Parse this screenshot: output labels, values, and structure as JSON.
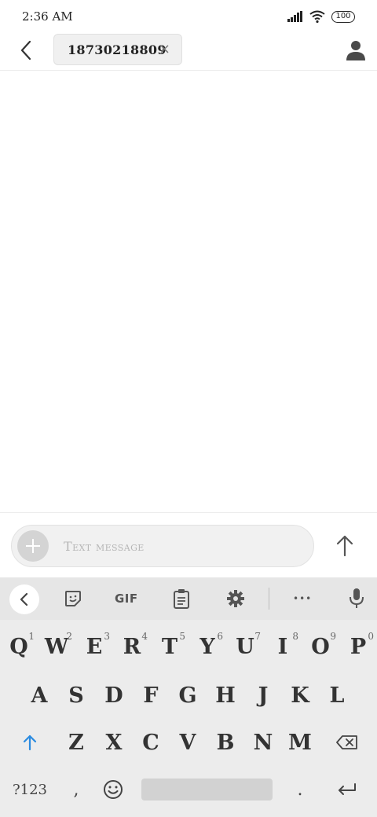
{
  "status_bar": {
    "time": "2:36 AM",
    "battery_level": "100",
    "icons": [
      "signal-icon",
      "wifi-icon",
      "battery-icon"
    ]
  },
  "header": {
    "recipient_chip": "18730218809",
    "chip_remove_symbol": "×"
  },
  "composer": {
    "placeholder": "Text message"
  },
  "keyboard": {
    "toolbar": {
      "gif_label": "GIF",
      "more_symbol": "•••"
    },
    "row1": [
      {
        "key": "Q",
        "hint": "1"
      },
      {
        "key": "W",
        "hint": "2"
      },
      {
        "key": "E",
        "hint": "3"
      },
      {
        "key": "R",
        "hint": "4"
      },
      {
        "key": "T",
        "hint": "5"
      },
      {
        "key": "Y",
        "hint": "6"
      },
      {
        "key": "U",
        "hint": "7"
      },
      {
        "key": "I",
        "hint": "8"
      },
      {
        "key": "O",
        "hint": "9"
      },
      {
        "key": "P",
        "hint": "0"
      }
    ],
    "row2": [
      "A",
      "S",
      "D",
      "F",
      "G",
      "H",
      "J",
      "K",
      "L"
    ],
    "row3": [
      "Z",
      "X",
      "C",
      "V",
      "B",
      "N",
      "M"
    ],
    "bottom_row": {
      "symbols_label": "?123",
      "comma": ",",
      "period": "."
    }
  }
}
